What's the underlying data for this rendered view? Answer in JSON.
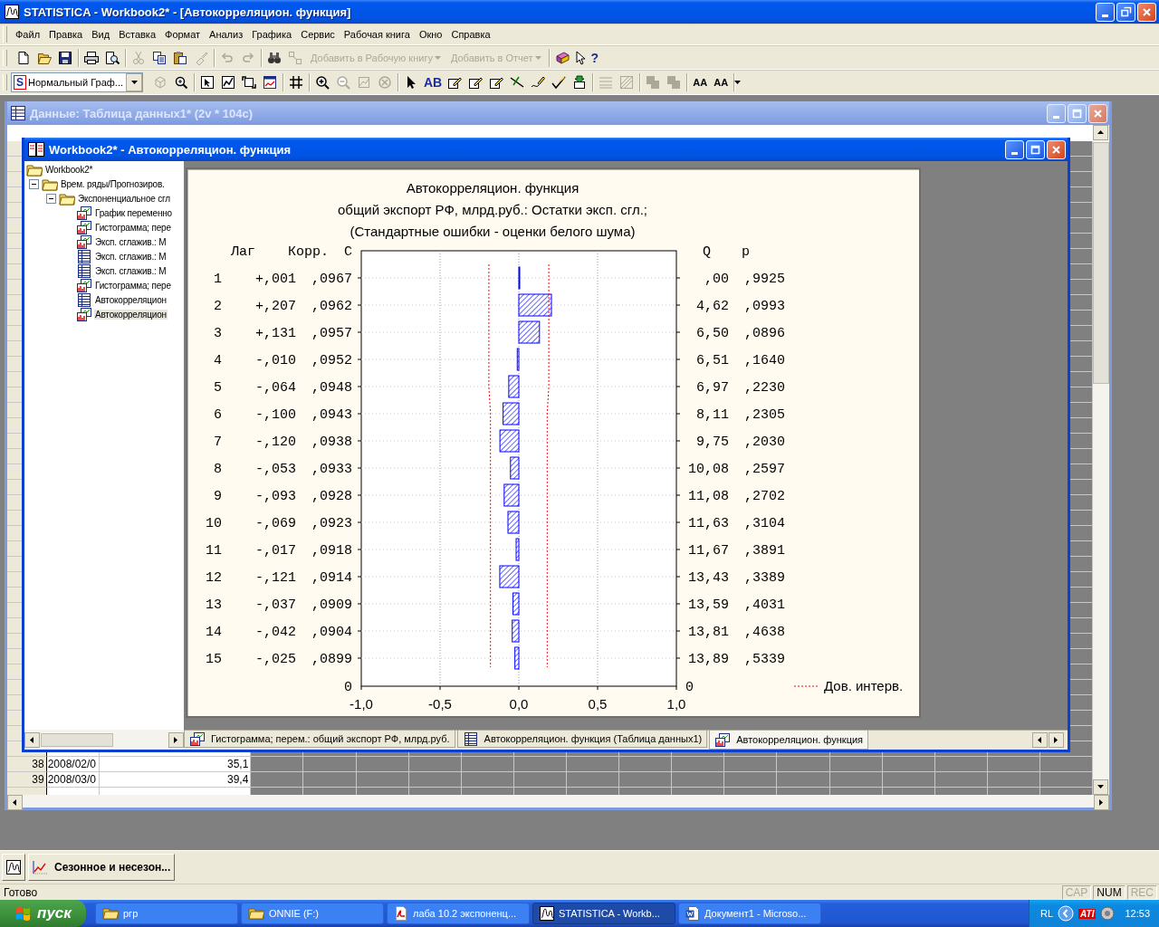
{
  "window": {
    "title": "STATISTICA - Workbook2* - [Автокорреляцион. функция]"
  },
  "menu": [
    "Файл",
    "Правка",
    "Вид",
    "Вставка",
    "Формат",
    "Анализ",
    "Графика",
    "Сервис",
    "Рабочая книга",
    "Окно",
    "Справка"
  ],
  "toolbar_1": [
    [
      {
        "kind": "new",
        "disabled": false
      },
      {
        "kind": "open",
        "disabled": false
      },
      {
        "kind": "save",
        "disabled": false
      }
    ],
    [
      {
        "kind": "print",
        "disabled": false
      },
      {
        "kind": "preview",
        "disabled": false
      }
    ],
    [
      {
        "kind": "cut",
        "disabled": true
      },
      {
        "kind": "copy",
        "disabled": false
      },
      {
        "kind": "paste",
        "disabled": false
      },
      {
        "kind": "brush",
        "disabled": true
      }
    ],
    [
      {
        "kind": "undo",
        "disabled": true
      },
      {
        "kind": "redo",
        "disabled": true
      }
    ],
    [
      {
        "kind": "binoculars",
        "disabled": false
      },
      {
        "kind": "link",
        "disabled": true
      },
      {
        "kind": "menu",
        "label": "Добавить в Рабочую книгу",
        "disabled": true
      },
      {
        "kind": "menu",
        "label": "Добавить в Отчет",
        "disabled": true
      }
    ],
    [
      {
        "kind": "book",
        "disabled": false
      },
      {
        "kind": "help",
        "glyph": "?",
        "disabled": false
      }
    ]
  ],
  "graph_style": {
    "badge": "S",
    "value": "Нормальный Граф..."
  },
  "toolbar_2": [
    [
      {
        "kind": "graph3d",
        "disabled": true
      },
      {
        "kind": "zoom-graph",
        "disabled": false
      }
    ],
    [
      {
        "kind": "select",
        "disabled": false
      },
      {
        "kind": "chart-edit",
        "disabled": false
      },
      {
        "kind": "chart-refresh",
        "disabled": false
      },
      {
        "kind": "chart-window",
        "disabled": false
      }
    ],
    [
      {
        "kind": "grid",
        "disabled": false
      }
    ],
    [
      {
        "kind": "zoom-in",
        "disabled": false
      },
      {
        "kind": "zoom-out",
        "disabled": true
      },
      {
        "kind": "zoom-scale",
        "disabled": true
      },
      {
        "kind": "zoom-reset",
        "disabled": true
      }
    ],
    [
      {
        "kind": "pointer",
        "disabled": false
      },
      {
        "kind": "text",
        "glyph": "AB",
        "disabled": false
      },
      {
        "kind": "note",
        "disabled": false
      },
      {
        "kind": "note",
        "disabled": false
      },
      {
        "kind": "note",
        "disabled": false
      },
      {
        "kind": "line-tool",
        "disabled": false
      },
      {
        "kind": "pen-tool",
        "disabled": false
      },
      {
        "kind": "check-tool",
        "disabled": false
      },
      {
        "kind": "stamp",
        "disabled": false
      }
    ],
    [
      {
        "kind": "lines",
        "disabled": true
      },
      {
        "kind": "hatch",
        "disabled": true
      }
    ],
    [
      {
        "kind": "layer",
        "disabled": true
      },
      {
        "kind": "layer",
        "disabled": true
      }
    ],
    [
      {
        "kind": "font",
        "glyph": "AA",
        "disabled": false
      },
      {
        "kind": "font",
        "glyph": "AA",
        "disabled": false
      }
    ]
  ],
  "data_window": {
    "title": "Данные: Таблица данных1* (2v * 104c)",
    "rows": [
      {
        "num": "38",
        "date": "2008/02/0",
        "value": "35,1"
      },
      {
        "num": "39",
        "date": "2008/03/0",
        "value": "39,4"
      }
    ]
  },
  "workbook_window": {
    "title": "Workbook2* - Автокорреляцион. функция",
    "tree": [
      {
        "label": "Workbook2*",
        "kind": "folder",
        "selected": false,
        "children": [
          {
            "label": "Врем. ряды/Прогнозиров.",
            "kind": "folder",
            "expanded": true,
            "selected": false,
            "children": [
              {
                "label": "Экспоненциальное сгл",
                "kind": "folder",
                "expanded": true,
                "selected": false,
                "children": [
                  {
                    "label": "График переменно",
                    "kind": "graph",
                    "selected": false
                  },
                  {
                    "label": "Гистограмма; пере",
                    "kind": "graph",
                    "selected": false
                  },
                  {
                    "label": "Эксп. сглажив.: М",
                    "kind": "graph",
                    "selected": false
                  },
                  {
                    "label": "Эксп. сглажив.: М",
                    "kind": "table",
                    "selected": false
                  },
                  {
                    "label": "Эксп. сглажив.: М",
                    "kind": "table",
                    "selected": false
                  },
                  {
                    "label": "Гистограмма; пере",
                    "kind": "graph",
                    "selected": false
                  },
                  {
                    "label": "Автокорреляцион",
                    "kind": "table",
                    "selected": false
                  },
                  {
                    "label": "Автокорреляцион",
                    "kind": "graph",
                    "selected": true
                  }
                ]
              }
            ]
          }
        ]
      }
    ],
    "graph": {
      "title_lines": [
        "Автокорреляцион. функция",
        "общий экспорт РФ, млрд.руб.: Остатки эксп. сгл.;",
        "(Стандартные ошибки - оценки белого шума)"
      ],
      "table": {
        "columns": [
          "Лаг",
          "Корр.",
          "С",
          "Q",
          "p"
        ],
        "rows": [
          {
            "lag": "1",
            "corr": "+,001",
            "se": ",0967",
            "q": ",00",
            "p": ",9925"
          },
          {
            "lag": "2",
            "corr": "+,207",
            "se": ",0962",
            "q": "4,62",
            "p": ",0993"
          },
          {
            "lag": "3",
            "corr": "+,131",
            "se": ",0957",
            "q": "6,50",
            "p": ",0896"
          },
          {
            "lag": "4",
            "corr": "-,010",
            "se": ",0952",
            "q": "6,51",
            "p": ",1640"
          },
          {
            "lag": "5",
            "corr": "-,064",
            "se": ",0948",
            "q": "6,97",
            "p": ",2230"
          },
          {
            "lag": "6",
            "corr": "-,100",
            "se": ",0943",
            "q": "8,11",
            "p": ",2305"
          },
          {
            "lag": "7",
            "corr": "-,120",
            "se": ",0938",
            "q": "9,75",
            "p": ",2030"
          },
          {
            "lag": "8",
            "corr": "-,053",
            "se": ",0933",
            "q": "10,08",
            "p": ",2597"
          },
          {
            "lag": "9",
            "corr": "-,093",
            "se": ",0928",
            "q": "11,08",
            "p": ",2702"
          },
          {
            "lag": "10",
            "corr": "-,069",
            "se": ",0923",
            "q": "11,63",
            "p": ",3104"
          },
          {
            "lag": "11",
            "corr": "-,017",
            "se": ",0918",
            "q": "11,67",
            "p": ",3891"
          },
          {
            "lag": "12",
            "corr": "-,121",
            "se": ",0914",
            "q": "13,43",
            "p": ",3389"
          },
          {
            "lag": "13",
            "corr": "-,037",
            "se": ",0909",
            "q": "13,59",
            "p": ",4031"
          },
          {
            "lag": "14",
            "corr": "-,042",
            "se": ",0904",
            "q": "13,81",
            "p": ",4638"
          },
          {
            "lag": "15",
            "corr": "-,025",
            "se": ",0899",
            "q": "13,89",
            "p": ",5339"
          }
        ],
        "bottom_labels": [
          "0",
          "0"
        ]
      },
      "chart_data": {
        "type": "bar",
        "orientation": "horizontal",
        "grid": true,
        "series": [
          {
            "color": "#0000ff",
            "values": [
              0.001,
              0.207,
              0.131,
              -0.01,
              -0.064,
              -0.1,
              -0.12,
              -0.053,
              -0.093,
              -0.069,
              -0.017,
              -0.121,
              -0.037,
              -0.042,
              -0.025
            ]
          },
          {
            "name": "Дов. интерв.",
            "color": "#ff0000",
            "type": "line",
            "line_style": "dashed",
            "values": [
              0.19,
              0.19,
              0.19,
              0.19,
              0.19,
              0.18,
              0.18,
              0.18,
              0.18,
              0.18,
              0.18,
              0.18,
              0.18,
              0.18,
              0.18
            ]
          },
          {
            "color": "#ff0000",
            "type": "line",
            "line_style": "dashed",
            "values": [
              -0.19,
              -0.19,
              -0.19,
              -0.19,
              -0.19,
              -0.18,
              -0.18,
              -0.18,
              -0.18,
              -0.18,
              -0.18,
              -0.18,
              -0.18,
              -0.18,
              -0.18
            ]
          }
        ],
        "xlim": [
          -1,
          1
        ],
        "xticks": [
          {
            "value": -1,
            "label": "-1,0"
          },
          {
            "value": -0.5,
            "label": "-0,5"
          },
          {
            "value": 0,
            "label": "0,0"
          },
          {
            "value": 0.5,
            "label": "0,5"
          },
          {
            "value": 1,
            "label": "1,0"
          }
        ]
      }
    },
    "tabs": [
      {
        "label": "Гистограмма; перем.: общий экспорт РФ, млрд.руб.",
        "kind": "graph",
        "selected": false
      },
      {
        "label": "Автокорреляцион. функция (Таблица данных1)",
        "kind": "table",
        "selected": false
      },
      {
        "label": "Автокорреляцион. функция",
        "kind": "graph",
        "selected": true
      }
    ]
  },
  "minimized": {
    "label": "Сезонное и несезон..."
  },
  "status_bar": {
    "text": "Готово",
    "indicators": [
      {
        "label": "CAP",
        "on": false
      },
      {
        "label": "NUM",
        "on": true
      },
      {
        "label": "REC",
        "on": false
      }
    ]
  },
  "taskbar": {
    "start": "пуск",
    "tasks": [
      {
        "label": "ргр",
        "kind": "folder",
        "selected": false
      },
      {
        "label": "ONNIE (F:)",
        "kind": "folder",
        "selected": false
      },
      {
        "label": "лаба 10.2 экспоненц...",
        "kind": "pdf",
        "selected": false
      },
      {
        "label": "STATISTICA - Workb...",
        "kind": "app",
        "selected": true
      },
      {
        "label": "Документ1 - Microso...",
        "kind": "word",
        "selected": false
      }
    ],
    "tray": {
      "lang": "RL",
      "badge": "ATI",
      "clock": "12:53"
    }
  }
}
